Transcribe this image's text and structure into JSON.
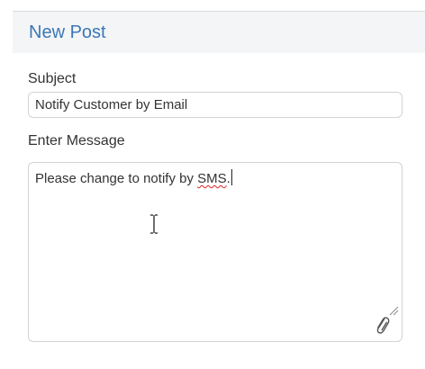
{
  "header": {
    "title": "New Post"
  },
  "form": {
    "subject_label": "Subject",
    "subject_value": "Notify Customer by Email",
    "message_label": "Enter Message",
    "message_value_prefix": "Please change to notify by ",
    "message_value_misspelled": "SMS",
    "message_value_suffix": "."
  },
  "icons": {
    "attach": "paperclip-icon",
    "resize": "resize-grip-icon",
    "cursor": "text-cursor-icon"
  },
  "colors": {
    "header_title": "#3b77b6",
    "header_background": "#f4f5f6",
    "border": "#d0d3d7",
    "spellcheck_underline": "#dd2222"
  }
}
